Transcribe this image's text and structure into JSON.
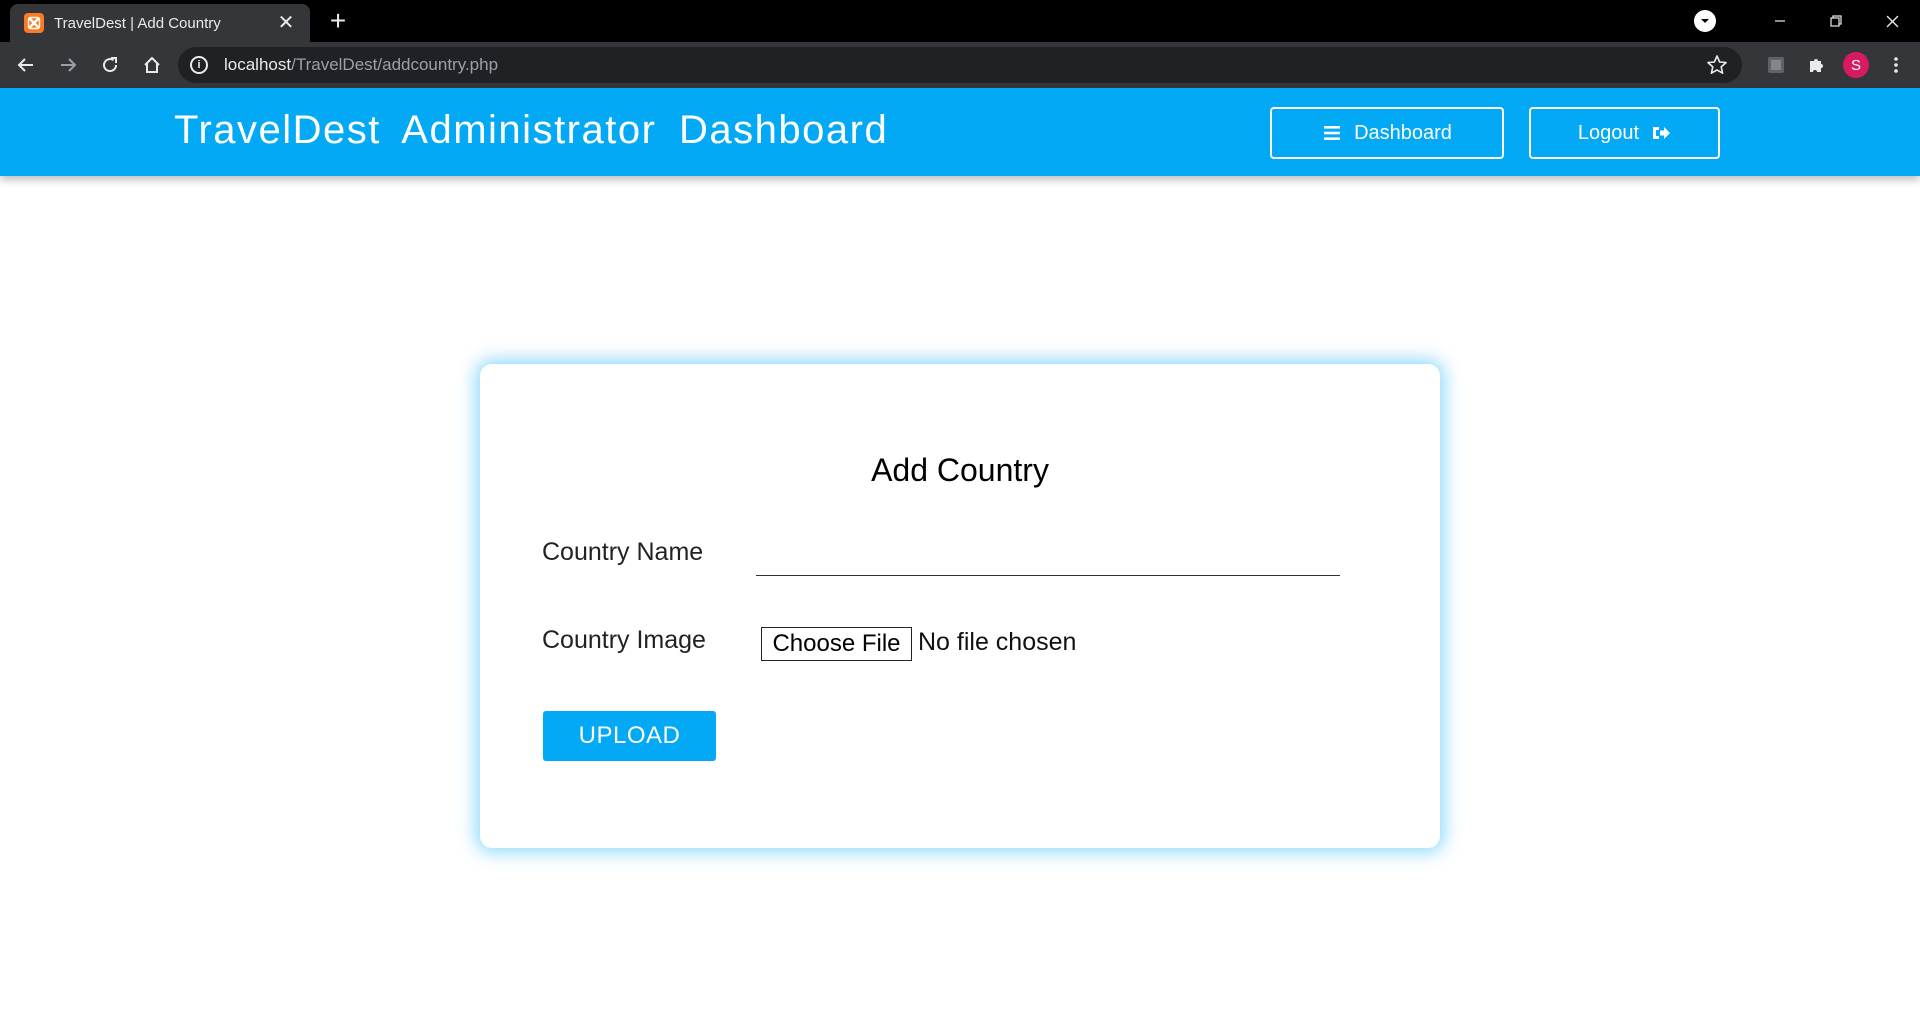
{
  "browser": {
    "tab_title": "TravelDest | Add Country",
    "tab_close": "✕",
    "new_tab": "+",
    "url_host": "localhost",
    "url_path": "/TravelDest/addcountry.php",
    "avatar_letter": "S",
    "icons": [
      "xampp-favicon",
      "download-icon",
      "minimize-icon",
      "restore-icon",
      "close-window-icon",
      "back-icon",
      "forward-icon",
      "reload-icon",
      "home-icon",
      "info-icon",
      "star-icon",
      "extension-icon",
      "puzzle-icon",
      "menu-dots-icon"
    ]
  },
  "header": {
    "title": "TravelDest  Administrator  Dashboard",
    "dashboard_label": "Dashboard",
    "logout_label": "Logout",
    "background": "#03a9f4"
  },
  "form": {
    "title": "Add Country",
    "country_name_label": "Country Name",
    "country_name_value": "",
    "country_image_label": "Country Image",
    "choose_file_label": "Choose File",
    "no_file_text": "No file chosen",
    "upload_label": "UPLOAD",
    "accent": "#03a9f4"
  }
}
